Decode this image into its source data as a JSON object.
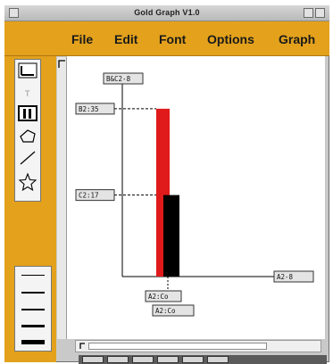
{
  "window": {
    "title": "Gold Graph V1.0"
  },
  "menu": {
    "items": [
      "File",
      "Edit",
      "Font",
      "Options",
      "Graph"
    ]
  },
  "tools": [
    "select-tool",
    "text-tool",
    "bar-tool",
    "ellipse-tool",
    "line-tool",
    "star-tool"
  ],
  "line_widths": [
    1,
    2,
    2,
    3,
    5
  ],
  "colors": {
    "accent": "#e3a11c",
    "bar_red": "#e01a1a",
    "bar_black": "#000000"
  },
  "chart_data": {
    "type": "bar",
    "ylabel": "B&C2-8",
    "xlabel": "A2-8",
    "x_tick_labels": [
      "A2:Co",
      "A2:Co"
    ],
    "value_labels": [
      "B2:35",
      "C2:17"
    ],
    "series": [
      {
        "values": [
          35
        ],
        "color": "#e01a1a"
      },
      {
        "values": [
          17
        ],
        "color": "#000000"
      }
    ],
    "ylim": [
      0,
      40
    ]
  }
}
